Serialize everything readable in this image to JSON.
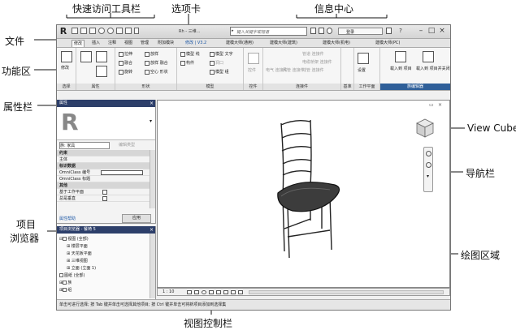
{
  "callouts": {
    "quick_access": "快速访问工具栏",
    "tabs": "选项卡",
    "info_center": "信息中心",
    "file": "文件",
    "ribbon": "功能区",
    "properties": "属性栏",
    "project_browser_1": "项目",
    "project_browser_2": "浏览器",
    "view_cube": "View Cube",
    "nav_bar": "导航栏",
    "drawing_area": "绘图区域",
    "view_control": "视图控制栏"
  },
  "titlebar": {
    "logo": "R",
    "title": "Rh - 三维...",
    "search_placeholder": "键入关键字或短语",
    "login": "登录",
    "help": "?"
  },
  "tabs": [
    "修改",
    "插入",
    "注释",
    "视图",
    "管理",
    "附加模块",
    "修改 | V3.2",
    "建模大师(通用)",
    "建模大师(建筑)",
    "建模大师(机电)",
    "建模大师(PC)"
  ],
  "ribbon": {
    "groups": [
      "选择",
      "属性",
      "形状",
      "模型",
      "控件",
      "连接件",
      "基准",
      "工作平面",
      "族编辑器"
    ],
    "modify_label": "修改",
    "shape_items": [
      "拉伸",
      "放样",
      "融合",
      "放样 融合",
      "旋转",
      "空心 形状"
    ],
    "model_items": [
      "模型 线",
      "模型 文字",
      "构件",
      "洞口",
      "模型 组"
    ],
    "control_label": "控件",
    "connector_items": [
      "电气 连接件",
      "风管 连接件",
      "管道 连接件",
      "电缆桥架 连接件",
      "线管 连接件"
    ],
    "workplane_label": "设置",
    "family_items": [
      "载入到 项目",
      "载入到 项目并关闭"
    ]
  },
  "properties": {
    "title": "属性",
    "type_label": "族: 家具",
    "edit_type": "编辑类型",
    "rows": [
      {
        "label": "约束",
        "section": true
      },
      {
        "label": "主体",
        "section": false
      },
      {
        "label": "标识数据",
        "section": true
      },
      {
        "label": "OmniClass 编号",
        "section": false,
        "field": true
      },
      {
        "label": "OmniClass 标题",
        "section": false,
        "field": true
      },
      {
        "label": "其他",
        "section": true
      },
      {
        "label": "基于工作平面",
        "section": false,
        "check": true
      },
      {
        "label": "总是垂直",
        "section": false,
        "check": true
      }
    ],
    "help": "属性帮助",
    "apply": "应用"
  },
  "browser": {
    "title": "项目浏览器 - 餐椅 5",
    "items": [
      "视图 (全部)",
      "楼层平面",
      "天花板平面",
      "三维视图",
      "立面 (立面 1)",
      "图纸 (全部)",
      "族",
      "组"
    ]
  },
  "view_control": {
    "scale": "1 : 10"
  },
  "statusbar": {
    "text": "单击可进行选择; 按 Tab 键并单击可选择其他项目; 按 Ctrl 键并单击可将新项目添加到选择集"
  }
}
